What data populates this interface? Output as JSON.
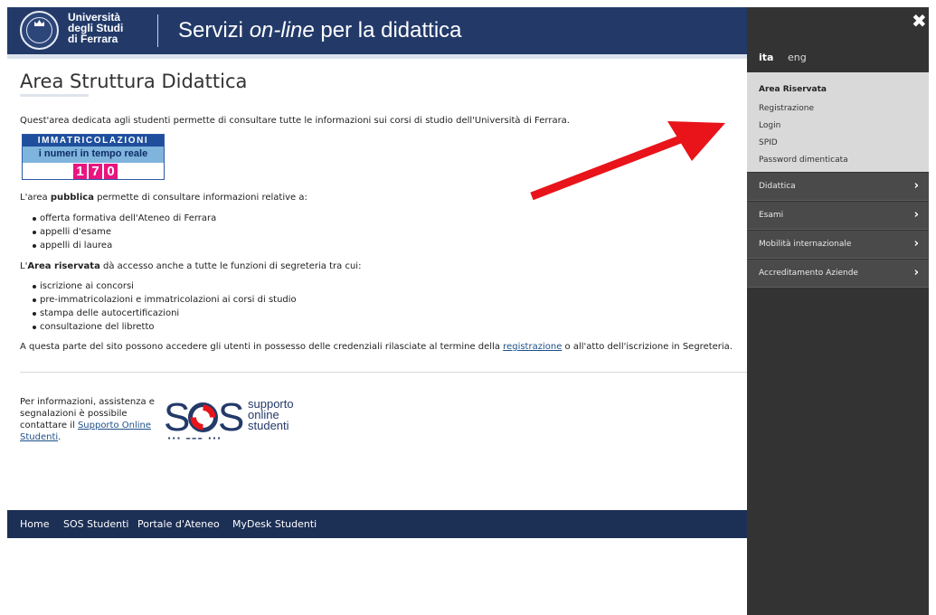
{
  "header": {
    "university_line1": "Università",
    "university_line2": "degli Studi",
    "university_line3": "di Ferrara",
    "title_prefix": "Servizi ",
    "title_italic": "on-line",
    "title_suffix": " per la didattica"
  },
  "main": {
    "page_title": "Area Struttura Didattica",
    "intro": "Quest'area dedicata agli studenti permette di consultare tutte le informazioni sui corsi di studio dell'Università di Ferrara.",
    "banner": {
      "line1": "IMMATRICOLAZIONI",
      "line2": "i numeri in tempo reale",
      "digits": [
        "1",
        "7",
        "0"
      ]
    },
    "public_pre": "L'area ",
    "public_bold": "pubblica",
    "public_post": " permette di consultare informazioni relative a:",
    "public_items": [
      "offerta formativa dell'Ateneo di Ferrara",
      "appelli d'esame",
      "appelli di laurea"
    ],
    "reserved_pre": "L'",
    "reserved_bold": "Area riservata",
    "reserved_post": " dà accesso anche a tutte le funzioni di segreteria tra cui:",
    "reserved_items": [
      "iscrizione ai concorsi",
      "pre-immatricolazioni e immatricolazioni ai corsi di studio",
      "stampa delle autocertificazioni",
      "consultazione del libretto"
    ],
    "access_pre": "A questa parte del sito possono accedere gli utenti in possesso delle credenziali rilasciate al termine della ",
    "access_link": "registrazione",
    "access_post": " o all'atto dell'iscrizione in Segreteria.",
    "info_pre": "Per informazioni, assistenza e segnalazioni è possibile contattare il ",
    "info_link": "Supporto Online Studenti",
    "info_post": ".",
    "sos": {
      "word_s1": "S",
      "word_s2": "S",
      "sub1": "supporto",
      "sub2": "online",
      "sub3": "studenti",
      "dots": "··· ––– ···"
    }
  },
  "footer": {
    "links": [
      "Home",
      "SOS Studenti",
      "Portale d'Ateneo",
      "MyDesk Studenti"
    ]
  },
  "side_panel": {
    "close_icon": "✖",
    "lang_active": "ita",
    "lang_other": "eng",
    "reserved_title": "Area Riservata",
    "reserved_items": [
      "Registrazione",
      "Login",
      "SPID",
      "Password dimenticata"
    ],
    "menu_items": [
      "Didattica",
      "Esami",
      "Mobilità internazionale",
      "Accreditamento Aziende"
    ],
    "chevron": "›"
  },
  "colors": {
    "header_bg": "#233a69",
    "panel_bg": "#333333",
    "arrow": "#e8141a",
    "banner_pink": "#e8157f"
  }
}
